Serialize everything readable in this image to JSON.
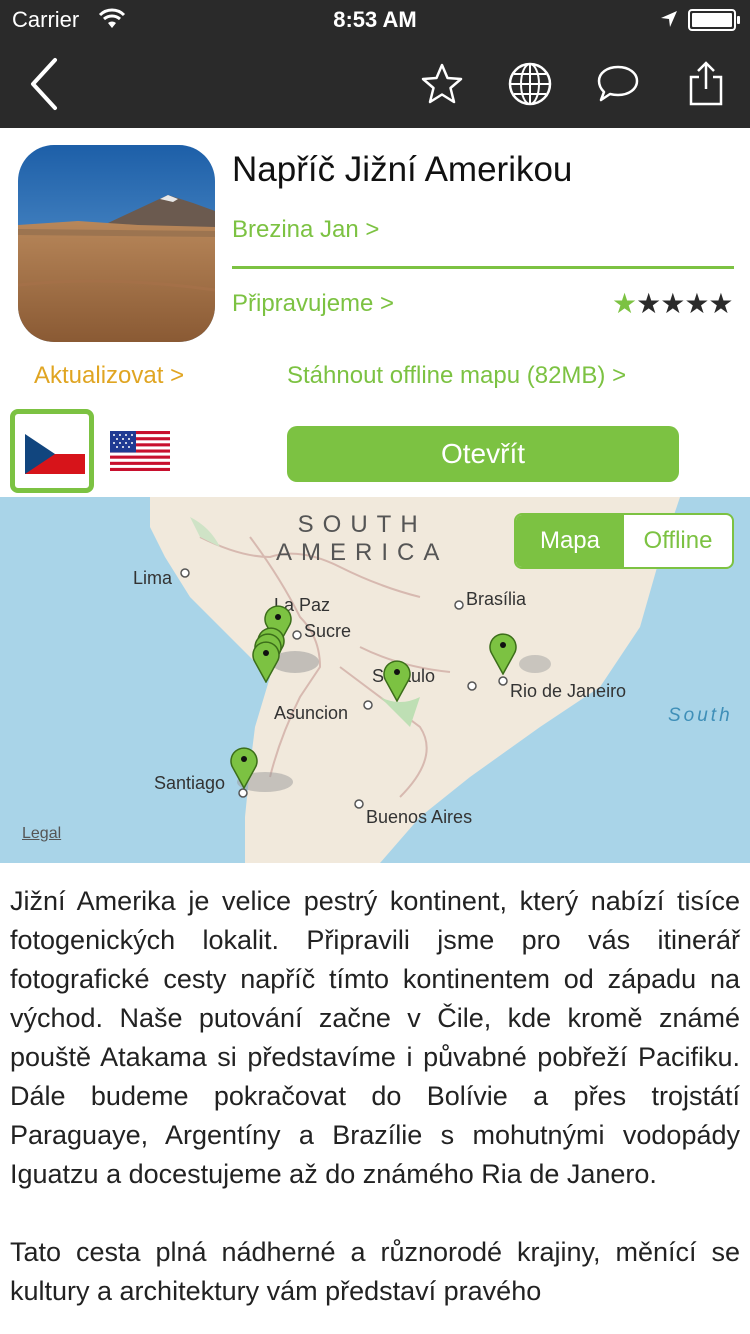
{
  "status_bar": {
    "carrier": "Carrier",
    "time": "8:53 AM"
  },
  "nav": {
    "icons": [
      "back-chevron-icon",
      "star-icon",
      "globe-icon",
      "chat-bubble-icon",
      "share-icon"
    ]
  },
  "guide": {
    "title": "Napříč Jižní Amerikou",
    "author": "Brezina Jan >",
    "status": "Připravujeme >",
    "rating": 1,
    "rating_max": 5,
    "update_link": "Aktualizovat >",
    "download_link": "Stáhnout offline mapu (82MB) >",
    "open_button": "Otevřít"
  },
  "languages": [
    {
      "code": "cz",
      "selected": true
    },
    {
      "code": "us",
      "selected": false
    }
  ],
  "map": {
    "toggle": {
      "map": "Mapa",
      "offline": "Offline"
    },
    "continent_line1": "SOUTH",
    "continent_line2": "AMERICA",
    "ocean": "South",
    "legal": "Legal",
    "cities": {
      "lima": "Lima",
      "lapaz": "La Paz",
      "sucre": "Sucre",
      "brasilia": "Brasília",
      "saopaulo": "S   Paulo",
      "rio": "Rio de Janeiro",
      "asuncion": "Asuncion",
      "santiago": "Santiago",
      "buenosaires": "Buenos Aires"
    }
  },
  "description": {
    "p1": "Jižní Amerika je velice pestrý kontinent, který nabízí tisíce fotogenických lokalit. Připravili jsme pro vás itinerář fotografické cesty napříč tímto kontinentem od západu na východ. Naše putování začne v Čile, kde kromě známé pouště Atakama si představíme i půvabné pobřeží Pacifiku. Dále budeme pokračovat do Bolívie a přes trojstátí Paraguaye, Argentíny a Brazílie s mohutnými vodopády Iguatzu a docestujeme až do známého Ria de Janero.",
    "p2": "Tato cesta plná nádherné a různorodé krajiny, měnící se kultury a architektury vám představí pravého"
  },
  "colors": {
    "accent": "#7cc242",
    "update": "#e0a522",
    "bar": "#2a2a2a"
  }
}
